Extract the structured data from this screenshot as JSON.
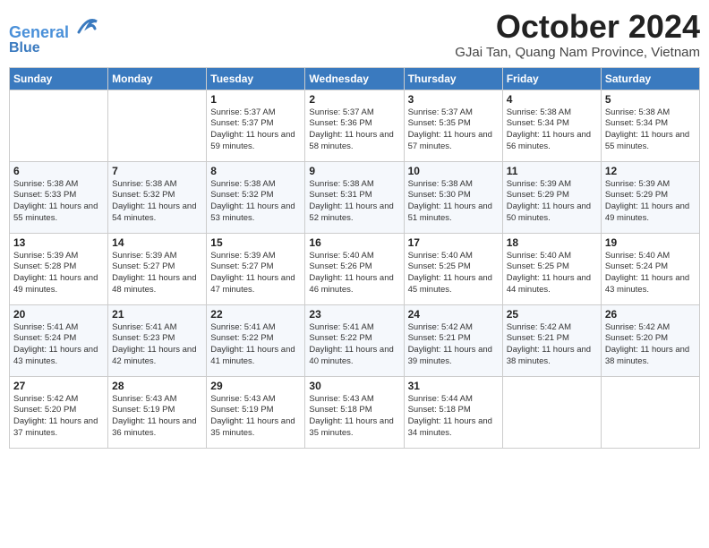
{
  "header": {
    "logo_line1": "General",
    "logo_line2": "Blue",
    "month": "October 2024",
    "location": "GJai Tan, Quang Nam Province, Vietnam"
  },
  "days_of_week": [
    "Sunday",
    "Monday",
    "Tuesday",
    "Wednesday",
    "Thursday",
    "Friday",
    "Saturday"
  ],
  "weeks": [
    [
      {
        "day": "",
        "content": ""
      },
      {
        "day": "",
        "content": ""
      },
      {
        "day": "1",
        "content": "Sunrise: 5:37 AM\nSunset: 5:37 PM\nDaylight: 11 hours and 59 minutes."
      },
      {
        "day": "2",
        "content": "Sunrise: 5:37 AM\nSunset: 5:36 PM\nDaylight: 11 hours and 58 minutes."
      },
      {
        "day": "3",
        "content": "Sunrise: 5:37 AM\nSunset: 5:35 PM\nDaylight: 11 hours and 57 minutes."
      },
      {
        "day": "4",
        "content": "Sunrise: 5:38 AM\nSunset: 5:34 PM\nDaylight: 11 hours and 56 minutes."
      },
      {
        "day": "5",
        "content": "Sunrise: 5:38 AM\nSunset: 5:34 PM\nDaylight: 11 hours and 55 minutes."
      }
    ],
    [
      {
        "day": "6",
        "content": "Sunrise: 5:38 AM\nSunset: 5:33 PM\nDaylight: 11 hours and 55 minutes."
      },
      {
        "day": "7",
        "content": "Sunrise: 5:38 AM\nSunset: 5:32 PM\nDaylight: 11 hours and 54 minutes."
      },
      {
        "day": "8",
        "content": "Sunrise: 5:38 AM\nSunset: 5:32 PM\nDaylight: 11 hours and 53 minutes."
      },
      {
        "day": "9",
        "content": "Sunrise: 5:38 AM\nSunset: 5:31 PM\nDaylight: 11 hours and 52 minutes."
      },
      {
        "day": "10",
        "content": "Sunrise: 5:38 AM\nSunset: 5:30 PM\nDaylight: 11 hours and 51 minutes."
      },
      {
        "day": "11",
        "content": "Sunrise: 5:39 AM\nSunset: 5:29 PM\nDaylight: 11 hours and 50 minutes."
      },
      {
        "day": "12",
        "content": "Sunrise: 5:39 AM\nSunset: 5:29 PM\nDaylight: 11 hours and 49 minutes."
      }
    ],
    [
      {
        "day": "13",
        "content": "Sunrise: 5:39 AM\nSunset: 5:28 PM\nDaylight: 11 hours and 49 minutes."
      },
      {
        "day": "14",
        "content": "Sunrise: 5:39 AM\nSunset: 5:27 PM\nDaylight: 11 hours and 48 minutes."
      },
      {
        "day": "15",
        "content": "Sunrise: 5:39 AM\nSunset: 5:27 PM\nDaylight: 11 hours and 47 minutes."
      },
      {
        "day": "16",
        "content": "Sunrise: 5:40 AM\nSunset: 5:26 PM\nDaylight: 11 hours and 46 minutes."
      },
      {
        "day": "17",
        "content": "Sunrise: 5:40 AM\nSunset: 5:25 PM\nDaylight: 11 hours and 45 minutes."
      },
      {
        "day": "18",
        "content": "Sunrise: 5:40 AM\nSunset: 5:25 PM\nDaylight: 11 hours and 44 minutes."
      },
      {
        "day": "19",
        "content": "Sunrise: 5:40 AM\nSunset: 5:24 PM\nDaylight: 11 hours and 43 minutes."
      }
    ],
    [
      {
        "day": "20",
        "content": "Sunrise: 5:41 AM\nSunset: 5:24 PM\nDaylight: 11 hours and 43 minutes."
      },
      {
        "day": "21",
        "content": "Sunrise: 5:41 AM\nSunset: 5:23 PM\nDaylight: 11 hours and 42 minutes."
      },
      {
        "day": "22",
        "content": "Sunrise: 5:41 AM\nSunset: 5:22 PM\nDaylight: 11 hours and 41 minutes."
      },
      {
        "day": "23",
        "content": "Sunrise: 5:41 AM\nSunset: 5:22 PM\nDaylight: 11 hours and 40 minutes."
      },
      {
        "day": "24",
        "content": "Sunrise: 5:42 AM\nSunset: 5:21 PM\nDaylight: 11 hours and 39 minutes."
      },
      {
        "day": "25",
        "content": "Sunrise: 5:42 AM\nSunset: 5:21 PM\nDaylight: 11 hours and 38 minutes."
      },
      {
        "day": "26",
        "content": "Sunrise: 5:42 AM\nSunset: 5:20 PM\nDaylight: 11 hours and 38 minutes."
      }
    ],
    [
      {
        "day": "27",
        "content": "Sunrise: 5:42 AM\nSunset: 5:20 PM\nDaylight: 11 hours and 37 minutes."
      },
      {
        "day": "28",
        "content": "Sunrise: 5:43 AM\nSunset: 5:19 PM\nDaylight: 11 hours and 36 minutes."
      },
      {
        "day": "29",
        "content": "Sunrise: 5:43 AM\nSunset: 5:19 PM\nDaylight: 11 hours and 35 minutes."
      },
      {
        "day": "30",
        "content": "Sunrise: 5:43 AM\nSunset: 5:18 PM\nDaylight: 11 hours and 35 minutes."
      },
      {
        "day": "31",
        "content": "Sunrise: 5:44 AM\nSunset: 5:18 PM\nDaylight: 11 hours and 34 minutes."
      },
      {
        "day": "",
        "content": ""
      },
      {
        "day": "",
        "content": ""
      }
    ]
  ]
}
